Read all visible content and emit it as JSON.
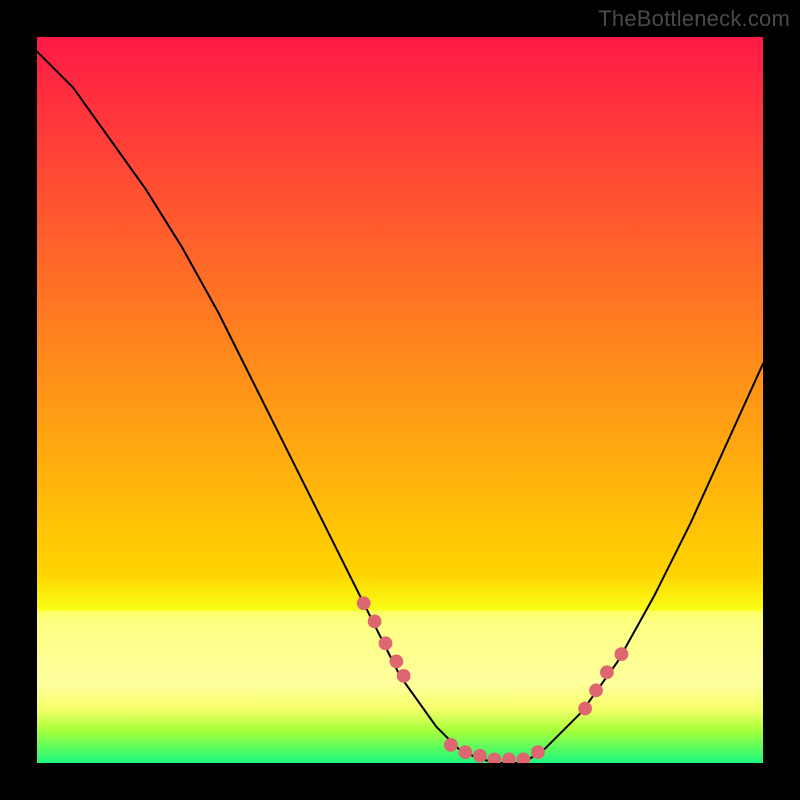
{
  "watermark": "TheBottleneck.com",
  "chart_data": {
    "type": "line",
    "title": "",
    "xlabel": "",
    "ylabel": "",
    "xlim": [
      0,
      100
    ],
    "ylim": [
      0,
      100
    ],
    "curve": {
      "x": [
        0,
        5,
        10,
        15,
        20,
        25,
        30,
        35,
        40,
        45,
        50,
        55,
        58,
        60,
        63,
        67,
        70,
        75,
        80,
        85,
        90,
        95,
        100
      ],
      "y": [
        98,
        93,
        86,
        79,
        71,
        62,
        52,
        42,
        32,
        22,
        12,
        5,
        2,
        1,
        0,
        0,
        2,
        7,
        14,
        23,
        33,
        44,
        55
      ]
    },
    "markers": {
      "x": [
        45.0,
        46.5,
        48.0,
        49.5,
        50.5,
        57.0,
        59.0,
        61.0,
        63.0,
        65.0,
        67.0,
        69.0,
        75.5,
        77.0,
        78.5,
        80.5
      ],
      "y": [
        22.0,
        19.5,
        16.5,
        14.0,
        12.0,
        2.5,
        1.5,
        1.0,
        0.5,
        0.5,
        0.5,
        1.5,
        7.5,
        10.0,
        12.5,
        15.0
      ]
    },
    "gradient_bands": [
      {
        "y0": 0,
        "y1": 74,
        "color0": "#ff1a46",
        "color1": "#ffd400"
      },
      {
        "y0": 74,
        "y1": 79,
        "color0": "#ffd400",
        "color1": "#f8ff18"
      },
      {
        "y0": 79,
        "y1": 80.7,
        "color0": "#f8ff18",
        "color1": "#fbff63"
      },
      {
        "y0": 80.7,
        "y1": 89,
        "color0": "#fbff63",
        "color1": "#ffffa0"
      },
      {
        "y0": 89,
        "y1": 92.5,
        "color0": "#ffff9a",
        "color1": "#f6ff6a"
      },
      {
        "y0": 92.5,
        "y1": 95.5,
        "color0": "#f6ff6a",
        "color1": "#a8ff3a"
      },
      {
        "y0": 95.5,
        "y1": 100,
        "color0": "#a8ff3a",
        "color1": "#19f87e"
      }
    ],
    "marker_color": "#de6670",
    "curve_color": "#000000"
  }
}
